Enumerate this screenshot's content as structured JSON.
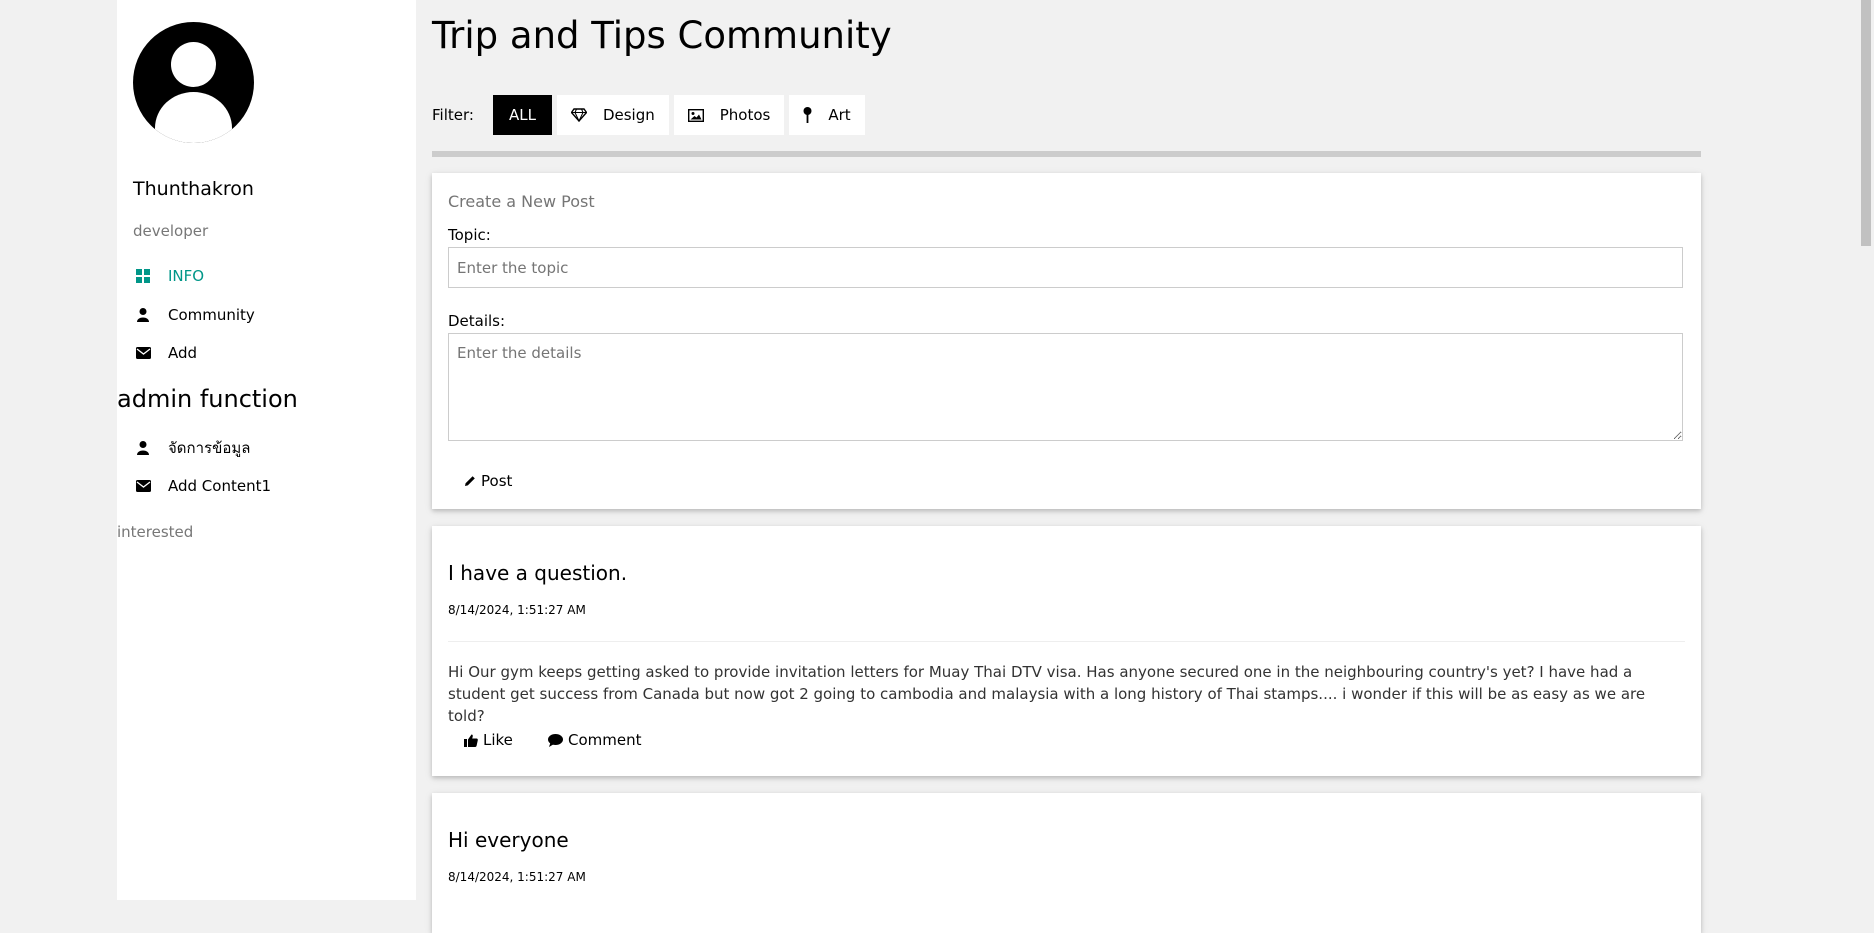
{
  "profile": {
    "name": "Thunthakron",
    "role": "developer"
  },
  "sidebar": {
    "items": [
      {
        "label": "INFO",
        "icon": "dashboard-icon",
        "active": true
      },
      {
        "label": "Community",
        "icon": "user-icon",
        "active": false
      },
      {
        "label": "Add",
        "icon": "envelope-icon",
        "active": false
      }
    ],
    "admin_title": "admin function",
    "admin_items": [
      {
        "label": "จัดการข้อมูล",
        "icon": "user-icon"
      },
      {
        "label": "Add Content1",
        "icon": "envelope-icon"
      }
    ],
    "interested_label": "interested"
  },
  "main": {
    "title": "Trip and Tips Community",
    "filter": {
      "label": "Filter:",
      "options": [
        {
          "label": "ALL",
          "icon": "",
          "active": true
        },
        {
          "label": "Design",
          "icon": "diamond-icon",
          "active": false
        },
        {
          "label": "Photos",
          "icon": "photo-icon",
          "active": false
        },
        {
          "label": "Art",
          "icon": "map-pin-icon",
          "active": false
        }
      ]
    },
    "create_post": {
      "title": "Create a New Post",
      "topic_label": "Topic:",
      "topic_placeholder": "Enter the topic",
      "details_label": "Details:",
      "details_placeholder": "Enter the details",
      "post_button": "Post"
    },
    "posts": [
      {
        "title": "I have a question.",
        "date": "8/14/2024, 1:51:27 AM",
        "body": "Hi Our gym keeps getting asked to provide invitation letters for Muay Thai DTV visa. Has anyone secured one in the neighbouring country's yet? I have had a student get success from Canada but now got 2 going to cambodia and malaysia with a long history of Thai stamps.... i wonder if this will be as easy as we are told?",
        "like_label": "Like",
        "comment_label": "Comment"
      },
      {
        "title": "Hi everyone",
        "date": "8/14/2024, 1:51:27 AM"
      }
    ]
  },
  "colors": {
    "accent": "#009688",
    "background": "#f1f1f1",
    "active_filter": "#000000"
  }
}
